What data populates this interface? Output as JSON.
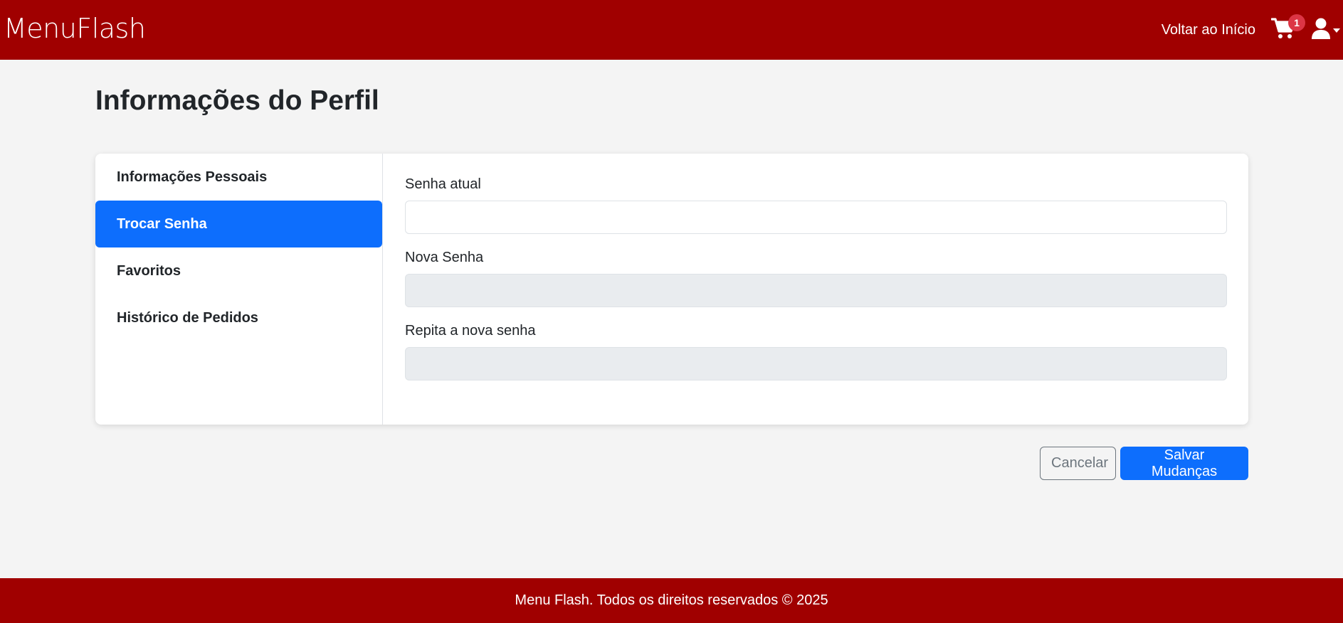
{
  "header": {
    "brand": "MenuFlash",
    "home_link": "Voltar ao Início",
    "cart_count": "1"
  },
  "page": {
    "title": "Informações do Perfil"
  },
  "sidebar": {
    "items": [
      {
        "label": "Informações Pessoais",
        "active": false
      },
      {
        "label": "Trocar Senha",
        "active": true
      },
      {
        "label": "Favoritos",
        "active": false
      },
      {
        "label": "Histórico de Pedidos",
        "active": false
      }
    ]
  },
  "form": {
    "current_password_label": "Senha atual",
    "current_password_value": "",
    "new_password_label": "Nova Senha",
    "new_password_value": "",
    "repeat_password_label": "Repita a nova senha",
    "repeat_password_value": ""
  },
  "actions": {
    "cancel_label": "Cancelar",
    "save_label": "Salvar Mudanças"
  },
  "footer": {
    "text": "Menu Flash. Todos os direitos reservados © 2025"
  },
  "colors": {
    "brand_red": "#a00000",
    "primary_blue": "#0d6efd",
    "badge_red": "#dc3545"
  },
  "icons": {
    "cart": "cart-icon",
    "user": "user-icon",
    "caret": "chevron-down-icon"
  }
}
